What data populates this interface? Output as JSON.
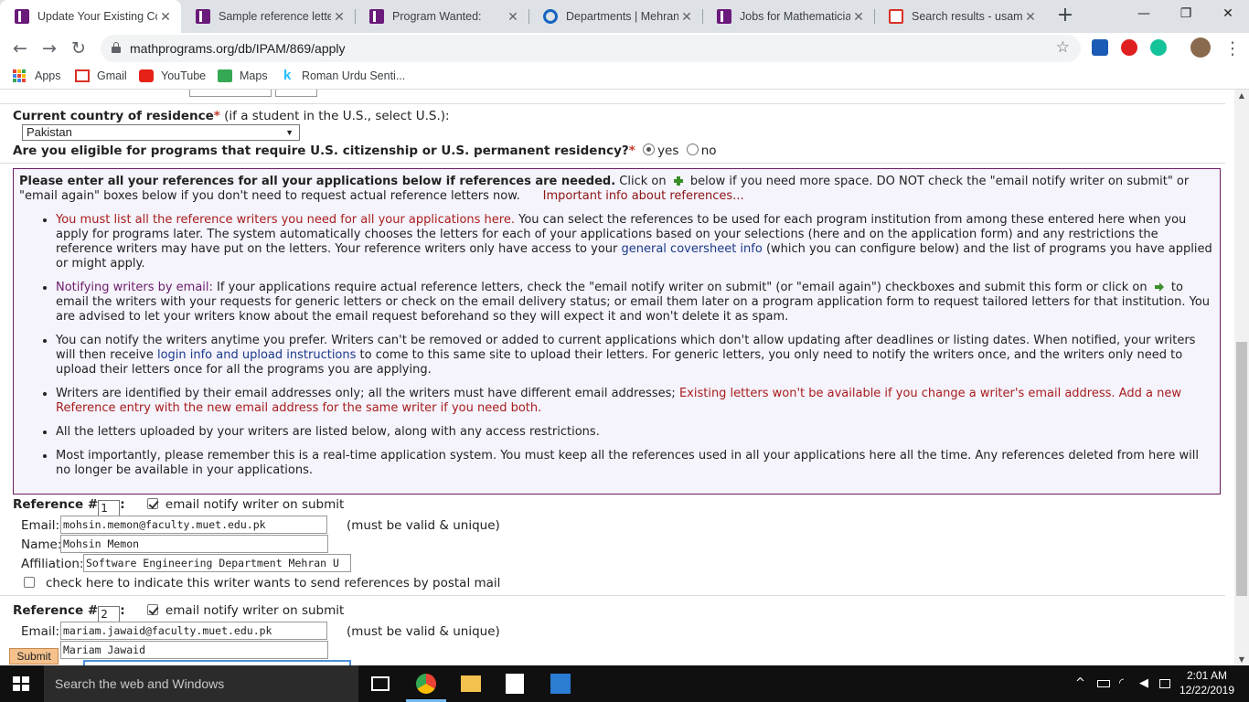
{
  "tabs": [
    {
      "title": "Update Your Existing Co",
      "favicon": "ipam-icon",
      "active": true
    },
    {
      "title": "Sample reference letter",
      "favicon": "ipam-icon",
      "active": false
    },
    {
      "title": "Program Wanted:",
      "favicon": "ipam-icon",
      "active": false
    },
    {
      "title": "Departments | Mehran U",
      "favicon": "gear-icon",
      "active": false
    },
    {
      "title": "Jobs for Mathematician",
      "favicon": "ipam-icon",
      "active": false
    },
    {
      "title": "Search results - usamaa",
      "favicon": "gmail-icon",
      "active": false
    }
  ],
  "window_controls": {
    "new_tab": "+",
    "minimize": "—",
    "maximize": "❐",
    "close": "✕"
  },
  "toolbar": {
    "url": "mathprograms.org/db/IPAM/869/apply",
    "back": "←",
    "forward": "→",
    "reload": "↻",
    "star": "☆",
    "menu": "⋮"
  },
  "bookmarks": [
    {
      "label": "Apps"
    },
    {
      "label": "Gmail"
    },
    {
      "label": "YouTube"
    },
    {
      "label": "Maps"
    },
    {
      "label": "Roman Urdu Senti..."
    }
  ],
  "form": {
    "cutoff_text": "(         )             (    )",
    "country": {
      "label": "Current country of residence",
      "required_mark": "*",
      "note": " (if a student in the U.S., select U.S.):",
      "value": "Pakistan"
    },
    "eligibility": {
      "label": "Are you eligible for programs that require U.S. citizenship or U.S. permanent residency?",
      "required_mark": "*",
      "yes_label": "yes",
      "no_label": "no",
      "selected": "yes"
    },
    "info": {
      "intro_bold": "Please enter all your references for all your applications below if references are needed.",
      "intro_a": " Click on ",
      "intro_b": " below if you need more space. DO NOT check the \"email notify writer on submit\" or \"email again\" boxes below if you don't need to request actual reference letters now.",
      "important_link": "Important info about references...",
      "b1_red": "You must list all the reference writers you need for all your applications here.",
      "b1_text": " You can select the references to be used for each program institution from among these entered here when you apply for programs later. The system automatically chooses the letters for each of your applications based on your selections (here and on the application form) and any restrictions the reference writers may have put on the letters. Your reference writers only have access to your ",
      "b1_link": "general coversheet info",
      "b1_text2": " (which you can configure below) and the list of programs you have applied or might apply.",
      "b2_purple": "Notifying writers by email:",
      "b2_text": " If your applications require actual reference letters, check the \"email notify writer on submit\" (or \"email again\") checkboxes and submit this form or click on ",
      "b2_text2": " to email the writers with your requests for generic letters or check on the email delivery status; or email them later on a program application form to request tailored letters for that institution. You are advised to let your writers know about the email request beforehand so they will expect it and won't delete it as spam.",
      "b3_text": "You can notify the writers anytime you prefer. Writers can't be removed or added to current applications which don't allow updating after deadlines or listing dates. When notified, your writers will then receive ",
      "b3_link": "login info and upload instructions",
      "b3_text2": " to come to this same site to upload their letters. For generic letters, you only need to notify the writers once, and the writers only need to upload their letters once for all the programs you are applying.",
      "b4_text": "Writers are identified by their email addresses only; all the writers must have different email addresses; ",
      "b4_red": "Existing letters won't be available if you change a writer's email address. Add a new Reference entry with the new email address for the same writer if you need both.",
      "b5_text": "All the letters uploaded by your writers are listed below, along with any access restrictions.",
      "b6_text": "Most importantly, please remember this is a real-time application system. You must keep all the references used in all your applications here all the time. Any references deleted from here will no longer be available in your applications."
    },
    "references": [
      {
        "heading": "Reference #",
        "number": "1",
        "colon": ":",
        "notify_label": "email notify writer on submit",
        "notify_checked": true,
        "email_label": "Email:",
        "email": "mohsin.memon@faculty.muet.edu.pk",
        "email_hint": "(must be valid & unique)",
        "name_label": "Name:",
        "name": "Mohsin Memon",
        "affiliation_label": "Affiliation:",
        "affiliation": "Software Engineering Department Mehran U",
        "postal_label": "check here to indicate this writer wants to send references by postal mail",
        "postal_checked": false
      },
      {
        "heading": "Reference #",
        "number": "2",
        "colon": ":",
        "notify_label": "email notify writer on submit",
        "notify_checked": true,
        "email_label": "Email:",
        "email": "mariam.jawaid@faculty.muet.edu.pk",
        "email_hint": "(must be valid & unique)",
        "name": "Mariam Jawaid"
      }
    ],
    "submit_label": "Submit"
  },
  "taskbar": {
    "search_placeholder": "Search the web and Windows",
    "time": "2:01 AM",
    "date": "12/22/2019",
    "tray_chevron": "^"
  },
  "colors": {
    "accent_purple": "#6b1d5f",
    "required_red": "#c0392b",
    "submit_orange": "#f5c28e"
  }
}
